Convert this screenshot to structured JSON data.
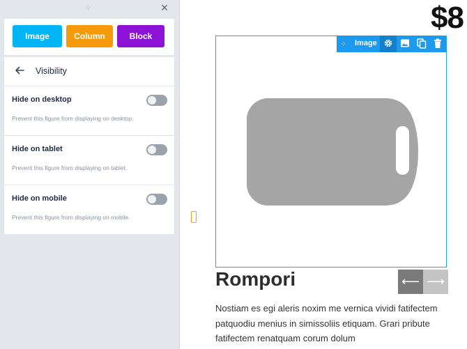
{
  "panel": {
    "drag_handle_icon": "drag-dots-icon",
    "close_icon": "close-icon",
    "close_glyph": "×",
    "tabs": [
      {
        "label": "Image",
        "color": "#00b5f5"
      },
      {
        "label": "Column",
        "color": "#f59b0b"
      },
      {
        "label": "Block",
        "color": "#8b12d6"
      }
    ],
    "visibility": {
      "back_icon": "arrow-left-icon",
      "title": "Visibility",
      "rows": [
        {
          "label": "Hide on desktop",
          "description": "Prevent this figure from displaying on desktop.",
          "enabled": false
        },
        {
          "label": "Hide on tablet",
          "description": "Prevent this figure from displaying on tablet.",
          "enabled": false
        },
        {
          "label": "Hide on mobile",
          "description": "Prevent this figure from displaying on mobile.",
          "enabled": false
        }
      ]
    }
  },
  "canvas": {
    "price": "$8",
    "image_toolbar": {
      "label": "Image",
      "color": "#1c9af0",
      "buttons": [
        "settings-icon",
        "image-icon",
        "duplicate-icon",
        "trash-icon"
      ]
    },
    "image_placeholder_icon": "cutting-board-icon",
    "product_title": "Rompori",
    "product_description": "Nostiam es egi aleris noxim me vernica vividi fatifectem patquodiu menius in simissoliis etiquam. Grari pribute fatifectem renatquam corum dolum",
    "nav": {
      "prev_icon": "arrow-left-icon",
      "next_icon": "arrow-right-icon"
    }
  }
}
